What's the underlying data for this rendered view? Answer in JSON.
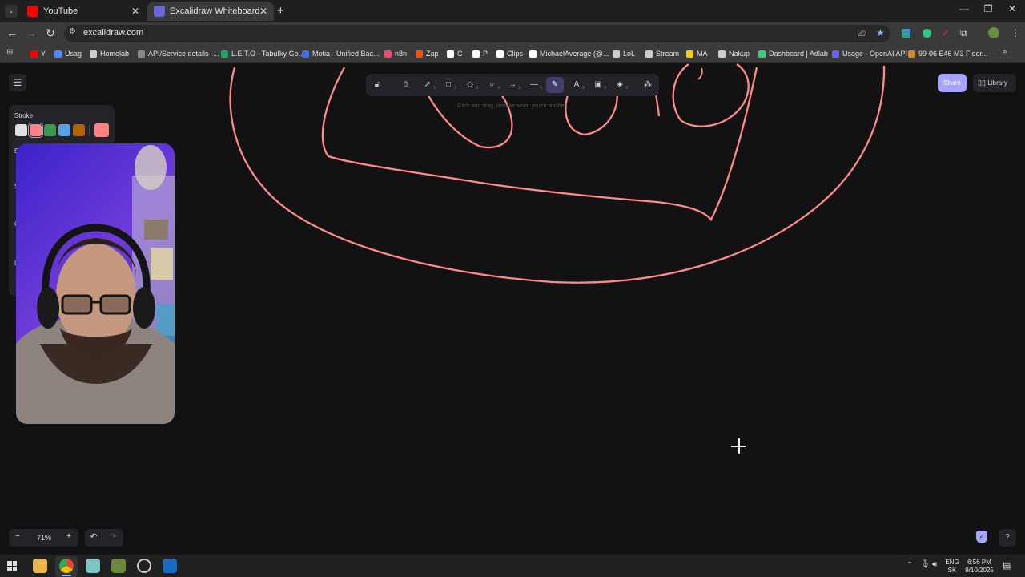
{
  "browser": {
    "tabs": [
      {
        "title": "YouTube",
        "icon": "youtube-icon",
        "active": false
      },
      {
        "title": "Excalidraw Whiteboard",
        "icon": "excalidraw-icon",
        "active": true
      }
    ],
    "url": "excalidraw.com",
    "bookmarks": [
      {
        "label": "Y",
        "icon": "youtube-icon",
        "color": "#ff0000"
      },
      {
        "label": "Usag",
        "icon": "globe-icon",
        "color": "#4a8cff"
      },
      {
        "label": "Homelab",
        "icon": "folder-icon",
        "color": "#cccccc"
      },
      {
        "label": "API/Service details -...",
        "icon": "gear-icon",
        "color": "#888888"
      },
      {
        "label": "L.E.T.O - Tabuľky Go...",
        "icon": "sheets-icon",
        "color": "#23a566"
      },
      {
        "label": "Motia - Unified Bac...",
        "icon": "motia-icon",
        "color": "#3a6df0"
      },
      {
        "label": "n8n",
        "icon": "n8n-icon",
        "color": "#ea4b71"
      },
      {
        "label": "Zap",
        "icon": "zapier-icon",
        "color": "#ff4a00"
      },
      {
        "label": "C",
        "icon": "c-icon",
        "color": "#ffffff"
      },
      {
        "label": "P",
        "icon": "p-icon",
        "color": "#ffffff"
      },
      {
        "label": "Clips",
        "icon": "clips-icon",
        "color": "#ffffff"
      },
      {
        "label": "MichaelAverage (@...",
        "icon": "tiktok-icon",
        "color": "#ffffff"
      },
      {
        "label": "LoL",
        "icon": "folder-icon",
        "color": "#cccccc"
      },
      {
        "label": "Stream",
        "icon": "folder-icon",
        "color": "#cccccc"
      },
      {
        "label": "MA",
        "icon": "ma-icon",
        "color": "#f5d000"
      },
      {
        "label": "Nakup",
        "icon": "folder-icon",
        "color": "#cccccc"
      },
      {
        "label": "Dashboard | Adlab",
        "icon": "adlab-icon",
        "color": "#2bd47d"
      },
      {
        "label": "Usage - OpenAI API",
        "icon": "openai-icon",
        "color": "#6a5cff"
      },
      {
        "label": "99-06 E46 M3 Floor...",
        "icon": "car-icon",
        "color": "#cc8833"
      }
    ]
  },
  "excalidraw": {
    "share_label": "Share",
    "library_label": "Library",
    "hint": "Click and drag, release when you're finished",
    "stroke_label": "Stroke",
    "stroke_swatches": [
      "#e0e0e0",
      "#ff8383",
      "#3a994c",
      "#56a2e8",
      "#b76100"
    ],
    "current_stroke": "#ff8383",
    "panel_stubs": [
      "Ba",
      "S",
      "O",
      "L"
    ],
    "zoom": "71%",
    "zoom_out": "−",
    "zoom_in": "+",
    "tools": [
      {
        "name": "lock-icon",
        "glyph": "🔓︎",
        "key": ""
      },
      {
        "name": "hand-icon",
        "glyph": "✋︎",
        "key": ""
      },
      {
        "name": "selection-icon",
        "glyph": "➚",
        "key": "1"
      },
      {
        "name": "rectangle-icon",
        "glyph": "□",
        "key": "2"
      },
      {
        "name": "diamond-icon",
        "glyph": "◇",
        "key": "3"
      },
      {
        "name": "ellipse-icon",
        "glyph": "○",
        "key": "4"
      },
      {
        "name": "arrow-icon",
        "glyph": "→",
        "key": "5"
      },
      {
        "name": "line-icon",
        "glyph": "—",
        "key": "6"
      },
      {
        "name": "pencil-icon",
        "glyph": "✎",
        "key": "7",
        "active": true
      },
      {
        "name": "text-icon",
        "glyph": "A",
        "key": "8"
      },
      {
        "name": "image-icon",
        "glyph": "▣",
        "key": "9"
      },
      {
        "name": "eraser-icon",
        "glyph": "◈",
        "key": "0"
      },
      {
        "name": "shapes-library-icon",
        "glyph": "⁂",
        "key": ""
      }
    ]
  },
  "taskbar": {
    "language": "ENG",
    "region": "SK",
    "time": "6:56 PM",
    "date": "9/10/2025"
  }
}
